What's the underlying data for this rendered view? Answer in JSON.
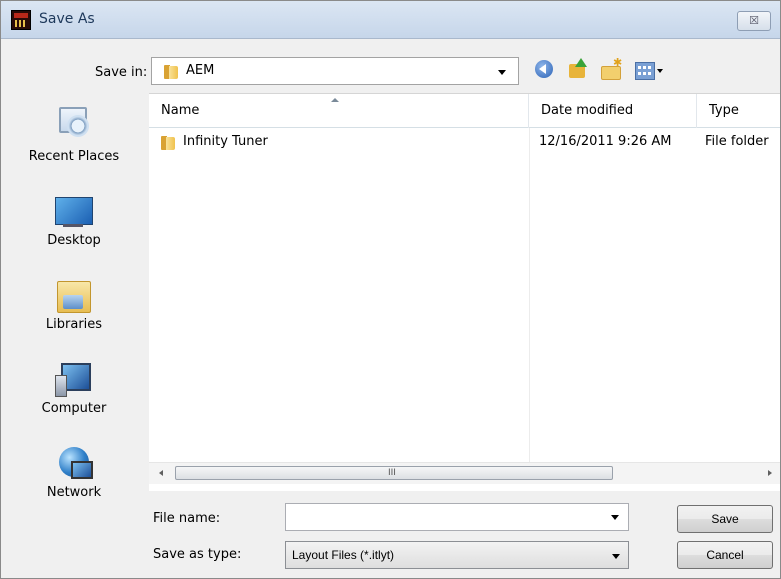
{
  "window": {
    "title": "Save As",
    "close_label": "☒"
  },
  "save_in": {
    "label": "Save in:",
    "value": "AEM"
  },
  "toolbar": {
    "icons": [
      "back-icon",
      "up-folder-icon",
      "new-folder-icon",
      "views-menu-icon"
    ]
  },
  "places": [
    {
      "label": "Recent Places",
      "icon": "recent-places-icon"
    },
    {
      "label": "Desktop",
      "icon": "desktop-icon"
    },
    {
      "label": "Libraries",
      "icon": "libraries-icon"
    },
    {
      "label": "Computer",
      "icon": "computer-icon"
    },
    {
      "label": "Network",
      "icon": "network-icon"
    }
  ],
  "file_list": {
    "columns": [
      "Name",
      "Date modified",
      "Type"
    ],
    "rows": [
      {
        "name": "Infinity Tuner",
        "date_modified": "12/16/2011 9:26 AM",
        "type": "File folder"
      }
    ],
    "scroll_grip": "III"
  },
  "file_name": {
    "label": "File name:",
    "value": ""
  },
  "save_as_type": {
    "label": "Save as type:",
    "value": "Layout Files (*.itlyt)"
  },
  "buttons": {
    "save": "Save",
    "cancel": "Cancel"
  }
}
